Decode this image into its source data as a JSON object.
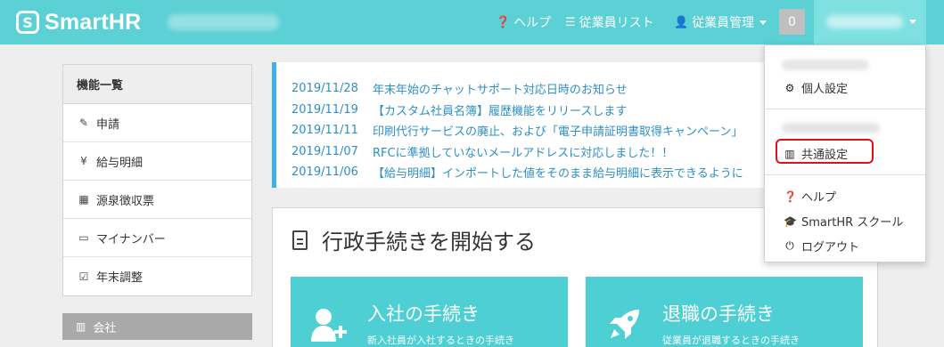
{
  "header": {
    "logo_mark": "S",
    "logo_text": "SmartHR",
    "nav": {
      "help_label": "ヘルプ",
      "employee_list_label": "従業員リスト",
      "employee_mgmt_label": "従業員管理"
    },
    "notification_count": "0",
    "colors": {
      "header": "#5bd0d5",
      "active_toggle": "#7fe0e2"
    }
  },
  "sidebar": {
    "title": "機能一覧",
    "items": [
      {
        "label": "申請",
        "icon": "application-icon",
        "glyph": "✎"
      },
      {
        "label": "給与明細",
        "icon": "payslip-icon",
        "glyph": "¥"
      },
      {
        "label": "源泉徴収票",
        "icon": "withholding-icon",
        "glyph": "▦"
      },
      {
        "label": "マイナンバー",
        "icon": "id-card-icon",
        "glyph": "▭"
      },
      {
        "label": "年末調整",
        "icon": "calendar-check-icon",
        "glyph": "☑"
      }
    ],
    "company_label": "会社"
  },
  "news": {
    "items": [
      {
        "date": "2019/11/28",
        "text": "年末年始のチャットサポート対応日時のお知らせ"
      },
      {
        "date": "2019/11/19",
        "text": "【カスタム社員名簿】履歴機能をリリースします"
      },
      {
        "date": "2019/11/11",
        "text": "印刷代行サービスの廃止、および「電子申請証明書取得キャンペーン」"
      },
      {
        "date": "2019/11/07",
        "text": "RFCに準拠していないメールアドレスに対応しました！！"
      },
      {
        "date": "2019/11/06",
        "text": "【給与明細】インポートした値をそのまま給与明細に表示できるように"
      }
    ],
    "accent_color": "#3fb0e8"
  },
  "procedures": {
    "title": "行政手続きを開始する",
    "cards": [
      {
        "title": "入社の手続き",
        "subtitle": "新入社員が入社するときの手続き",
        "icon": "add-user-icon"
      },
      {
        "title": "退職の手続き",
        "subtitle": "従業員が退職するときの手続き",
        "icon": "rocket-icon"
      }
    ],
    "card_color": "#4dcfd4"
  },
  "dropdown": {
    "personal_settings": "個人設定",
    "common_settings": "共通設定",
    "help": "ヘルプ",
    "school": "SmartHR スクール",
    "logout": "ログアウト",
    "highlight_color": "#e0101a"
  }
}
